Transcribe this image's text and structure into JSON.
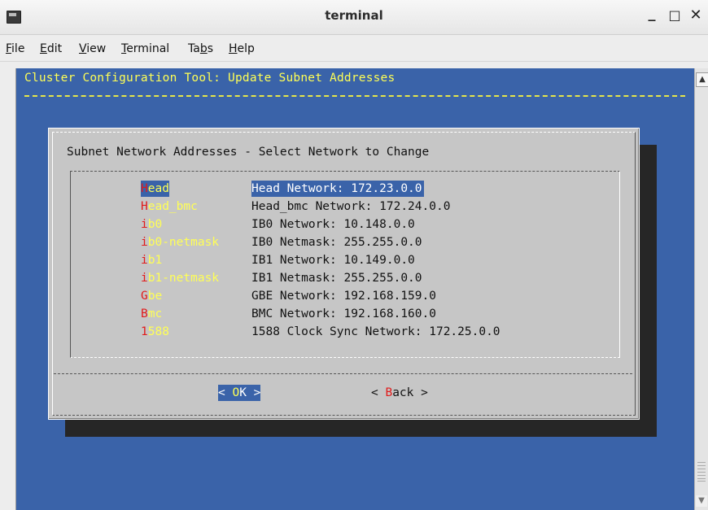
{
  "window": {
    "title": "terminal",
    "minimize": "_",
    "maximize": "□",
    "close": "✕"
  },
  "menubar": [
    {
      "pre": "",
      "u": "F",
      "post": "ile"
    },
    {
      "pre": "",
      "u": "E",
      "post": "dit"
    },
    {
      "pre": "",
      "u": "V",
      "post": "iew"
    },
    {
      "pre": "",
      "u": "T",
      "post": "erminal"
    },
    {
      "pre": "Ta",
      "u": "b",
      "post": "s"
    },
    {
      "pre": "",
      "u": "H",
      "post": "elp"
    }
  ],
  "terminal": {
    "header": "Cluster Configuration Tool: Update Subnet Addresses"
  },
  "dialog": {
    "title": "Subnet Network Addresses - Select Network to Change",
    "items": [
      {
        "hot": "H",
        "rest": "ead",
        "value": "Head Network: 172.23.0.0",
        "selected": true
      },
      {
        "hot": "H",
        "rest": "ead_bmc",
        "value": "Head_bmc Network: 172.24.0.0",
        "selected": false
      },
      {
        "hot": "i",
        "rest": "b0",
        "value": "IB0 Network: 10.148.0.0",
        "selected": false
      },
      {
        "hot": "i",
        "rest": "b0-netmask",
        "value": "IB0 Netmask: 255.255.0.0",
        "selected": false
      },
      {
        "hot": "i",
        "rest": "b1",
        "value": "IB1 Network: 10.149.0.0",
        "selected": false
      },
      {
        "hot": "i",
        "rest": "b1-netmask",
        "value": "IB1 Netmask: 255.255.0.0",
        "selected": false
      },
      {
        "hot": "G",
        "rest": "be",
        "value": "GBE Network: 192.168.159.0",
        "selected": false
      },
      {
        "hot": "B",
        "rest": "mc",
        "value": "BMC Network: 192.168.160.0",
        "selected": false
      },
      {
        "hot": "1",
        "rest": "588",
        "value": "1588 Clock Sync Network: 172.25.0.0",
        "selected": false
      }
    ],
    "ok": {
      "pre": "< ",
      "hot": "O",
      "rest": "K",
      "post": " >"
    },
    "back": {
      "pre": "< ",
      "hot": "B",
      "rest": "ack",
      "post": " >"
    }
  },
  "colors": {
    "terminal_bg": "#3a63a9",
    "dialog_bg": "#c6c6c6",
    "header_text": "#ffff55",
    "hotkey": "#e11a1a",
    "tag_text": "#ffff55"
  },
  "scrollbar": {
    "up_icon": "scroll-up-arrow-icon",
    "down_icon": "scroll-down-arrow-icon"
  }
}
